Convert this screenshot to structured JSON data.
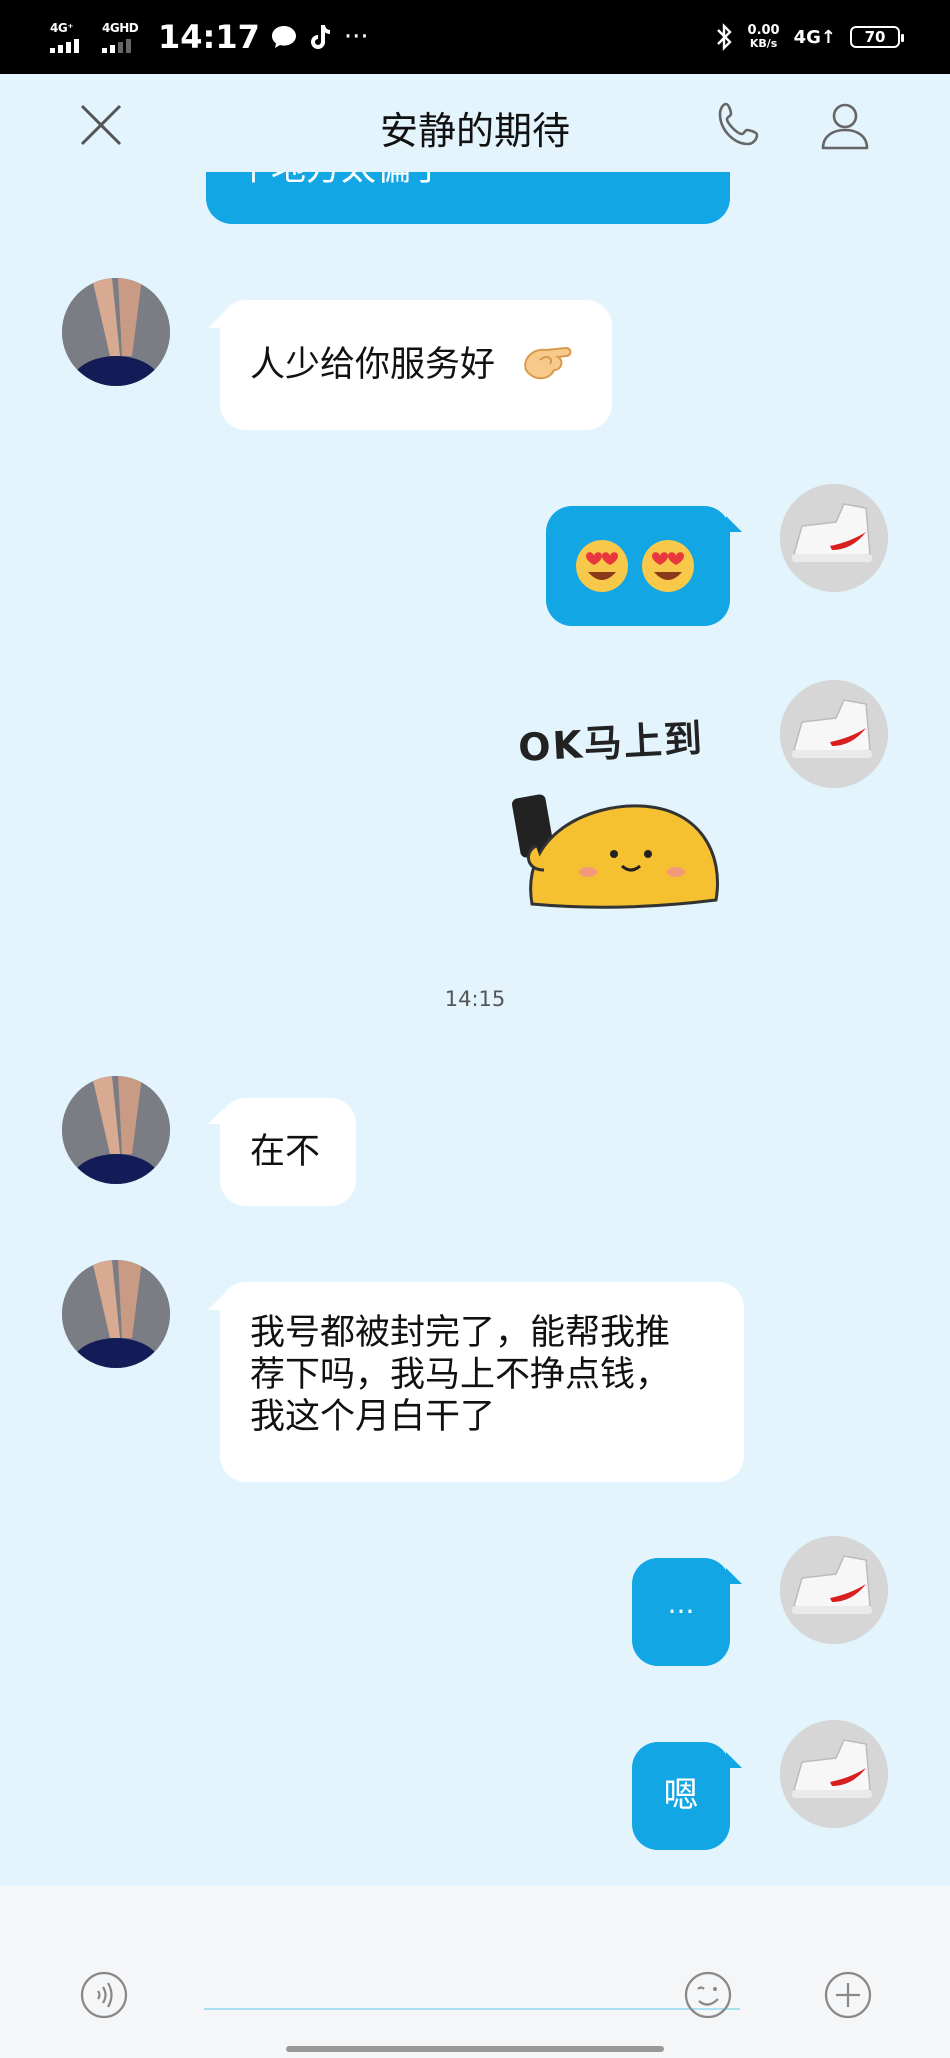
{
  "status_bar": {
    "net1": "4G⁺",
    "net2": "4GHD",
    "time": "14:17",
    "icons": [
      "chat-bubble-icon",
      "tiktok-icon",
      "more-icon"
    ],
    "more": "···",
    "speed_value": "0.00",
    "speed_unit": "KB/s",
    "net3": "4G↑",
    "battery": "70"
  },
  "header": {
    "title": "安静的期待"
  },
  "messages": {
    "partial_out": "个地方太偏了",
    "m1": "人少给你服务好",
    "m2_emoji": "😍😍",
    "sticker_text": "OK马上到",
    "timestamp": "14:15",
    "m3": "在不",
    "m4_line1": "我号都被封完了，能帮我推",
    "m4_line2": "荐下吗，我马上不挣点钱，",
    "m4_line3": "我这个月白干了",
    "m5": "···",
    "m6": "嗯"
  },
  "colors": {
    "background": "#e3f4fd",
    "outgoing_bubble": "#12a6e4",
    "incoming_bubble": "#ffffff",
    "input_bar": "#f5f6f8"
  }
}
